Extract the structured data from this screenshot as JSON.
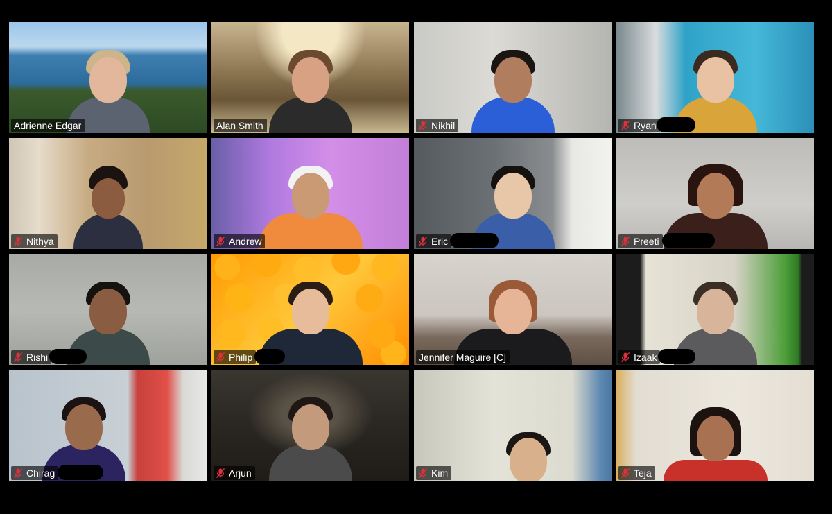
{
  "participants": [
    {
      "name": "Adrienne Edgar",
      "muted": false
    },
    {
      "name": "Alan Smith",
      "muted": false
    },
    {
      "name": "Nikhil",
      "muted": true
    },
    {
      "name": "Ryan",
      "muted": true
    },
    {
      "name": "Nithya",
      "muted": true
    },
    {
      "name": "Andrew",
      "muted": true
    },
    {
      "name": "Eric",
      "muted": true
    },
    {
      "name": "Preeti",
      "muted": true
    },
    {
      "name": "Rishi",
      "muted": true
    },
    {
      "name": "Philip",
      "muted": true
    },
    {
      "name": "Jennifer Maguire [C]",
      "muted": false
    },
    {
      "name": "Izaak",
      "muted": true
    },
    {
      "name": "Chirag",
      "muted": true
    },
    {
      "name": "Arjun",
      "muted": true
    },
    {
      "name": "Kim",
      "muted": true
    },
    {
      "name": "Teja",
      "muted": true
    }
  ],
  "colors": {
    "background": "#000000",
    "muted_mic": "#e0313b",
    "nametag_text": "#ffffff"
  },
  "icons": {
    "muted": "muted-microphone-icon"
  }
}
